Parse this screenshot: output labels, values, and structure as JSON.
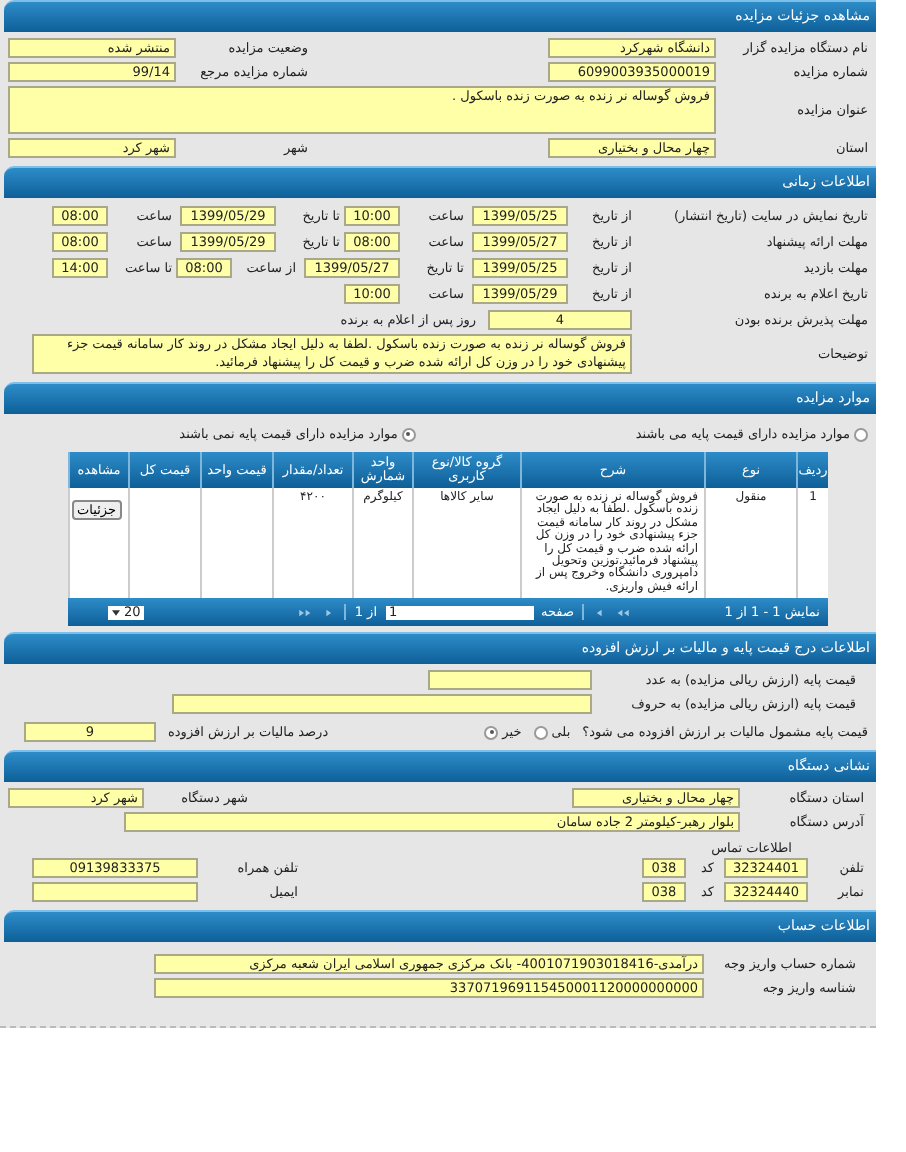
{
  "details": {
    "title": "مشاهده جزئیات مزایده",
    "rows": [
      {
        "kind": "pair",
        "items": [
          {
            "label": "نام دستگاه مزایده گزار",
            "value": "دانشگاه شهرکرد"
          },
          {
            "label": "وضعیت مزایده",
            "value": "منتشر شده"
          }
        ]
      },
      {
        "kind": "pair",
        "items": [
          {
            "label": "شماره مزایده",
            "value": "6099003935000019"
          },
          {
            "label": "شماره مزایده مرجع",
            "value": "99/14"
          }
        ]
      },
      {
        "kind": "wide",
        "items": [
          {
            "label": "عنوان مزایده",
            "value": "فروش گوساله نر زنده به صورت زنده باسکول ."
          }
        ]
      },
      {
        "kind": "pair",
        "items": [
          {
            "label": "استان",
            "value": "چهار محال و بختیاری"
          },
          {
            "label": "شهر",
            "value": "شهر کرد"
          }
        ]
      }
    ]
  },
  "time": {
    "title": "اطلاعات زمانی",
    "schedule": [
      {
        "label": "تاریخ نمایش در سایت (تاریخ انتشار)",
        "items": [
          {
            "label": "از تاریخ",
            "value": "1399/05/25",
            "kind": "date"
          },
          {
            "label": "ساعت",
            "value": "10:00",
            "kind": "time"
          },
          {
            "label": "تا تاریخ",
            "value": "1399/05/29",
            "kind": "date"
          },
          {
            "label": "ساعت",
            "value": "08:00",
            "kind": "time"
          }
        ]
      },
      {
        "label": "مهلت ارائه پیشنهاد",
        "items": [
          {
            "label": "از تاریخ",
            "value": "1399/05/27",
            "kind": "date"
          },
          {
            "label": "ساعت",
            "value": "08:00",
            "kind": "time"
          },
          {
            "label": "تا تاریخ",
            "value": "1399/05/29",
            "kind": "date"
          },
          {
            "label": "ساعت",
            "value": "08:00",
            "kind": "time"
          }
        ]
      },
      {
        "label": "مهلت بازدید",
        "items": [
          {
            "label": "از تاریخ",
            "value": "1399/05/25",
            "kind": "date"
          },
          {
            "label": "تا تاریخ",
            "value": "1399/05/27",
            "kind": "date"
          },
          {
            "label": "از ساعت",
            "value": "08:00",
            "kind": "time"
          },
          {
            "label": "تا ساعت",
            "value": "14:00",
            "kind": "time"
          }
        ]
      },
      {
        "label": "تاریخ اعلام به برنده",
        "items": [
          {
            "label": "از تاریخ",
            "value": "1399/05/29",
            "kind": "date"
          },
          {
            "label": "ساعت",
            "value": "10:00",
            "kind": "time"
          }
        ]
      }
    ],
    "acceptance": {
      "label": "مهلت پذیرش برنده بودن",
      "value": "4",
      "unit": "روز پس از اعلام به برنده"
    },
    "description": {
      "label": "توضیحات",
      "value": "فروش گوساله نر زنده به صورت زنده باسکول .لطفا به دلیل ایجاد مشکل در روند کار سامانه قیمت جزء پیشنهادی خود را در وزن کل ارائه شده ضرب و قیمت کل را پیشنهاد فرمائید."
    }
  },
  "items": {
    "title": "موارد مزایده",
    "options": [
      {
        "label": "موارد مزایده دارای قیمت پایه می باشند",
        "selected": false
      },
      {
        "label": "موارد مزایده دارای قیمت پایه نمی باشند",
        "selected": true
      }
    ],
    "table": {
      "columns": [
        "ردیف",
        "نوع",
        "شرح",
        "گروه کالا/نوع کاربری",
        "واحد شمارش",
        "تعداد/مقدار",
        "قیمت واحد",
        "قیمت کل",
        "مشاهده"
      ],
      "rows": [
        {
          "cells": [
            "1",
            "منقول",
            "فروش گوساله نر زنده به صورت زنده باسکول .لطفا به دلیل ایجاد مشکل در روند کار سامانه قیمت جزء پیشنهادی خود را در وزن کل ارائه شده ضرب و قیمت کل را پیشنهاد فرمائید.توزین وتحویل دامپروری دانشگاه وخروج پس از ارائه فیش واریزی.",
            "سایر کالاها",
            "کیلوگرم",
            "۴۲۰۰",
            "",
            ""
          ],
          "action": "جزئیات"
        }
      ],
      "pager": {
        "summary": "نمایش 1 - 1 از 1",
        "page_label": "صفحه",
        "page": "1",
        "of": "از 1",
        "page_size": "20"
      }
    }
  },
  "price": {
    "title": "اطلاعات درج قیمت پایه و مالیات بر ارزش افزوده",
    "digits_label": "قیمت پایه (ارزش ریالی مزایده) به عدد",
    "words_label": "قیمت پایه (ارزش ریالی مزایده) به حروف",
    "tax_question": "قیمت پایه مشمول مالیات بر ارزش افزوده می شود؟",
    "tax_options": [
      {
        "label": "بلی",
        "selected": false
      },
      {
        "label": "خیر",
        "selected": true
      }
    ],
    "tax_rate_label": "درصد مالیات بر ارزش افزوده",
    "tax_rate": "9"
  },
  "address": {
    "title": "نشانی دستگاه",
    "province": {
      "label": "استان دستگاه",
      "value": "چهار محال و بختیاری"
    },
    "city": {
      "label": "شهر دستگاه",
      "value": "شهر کرد"
    },
    "street": {
      "label": "آدرس دستگاه",
      "value": "بلوار رهبر-کیلومتر 2 جاده سامان"
    },
    "contact_title": "اطلاعات تماس",
    "phone": {
      "label": "تلفن",
      "value": "32324401",
      "code_label": "کد",
      "code": "038"
    },
    "fax": {
      "label": "نمابر",
      "value": "32324440",
      "code_label": "کد",
      "code": "038"
    },
    "mobile": {
      "label": "تلفن همراه",
      "value": "09139833375"
    },
    "email": {
      "label": "ایمیل"
    }
  },
  "account": {
    "title": "اطلاعات حساب",
    "rows": [
      {
        "label": "شماره حساب واریز وجه",
        "value": "درآمدی-4001071903018416- بانک مرکزی جمهوری اسلامی ایران شعبه مرکزی"
      },
      {
        "label": "شناسه واریز وجه",
        "value": "337071969115450001120000000000"
      }
    ]
  }
}
